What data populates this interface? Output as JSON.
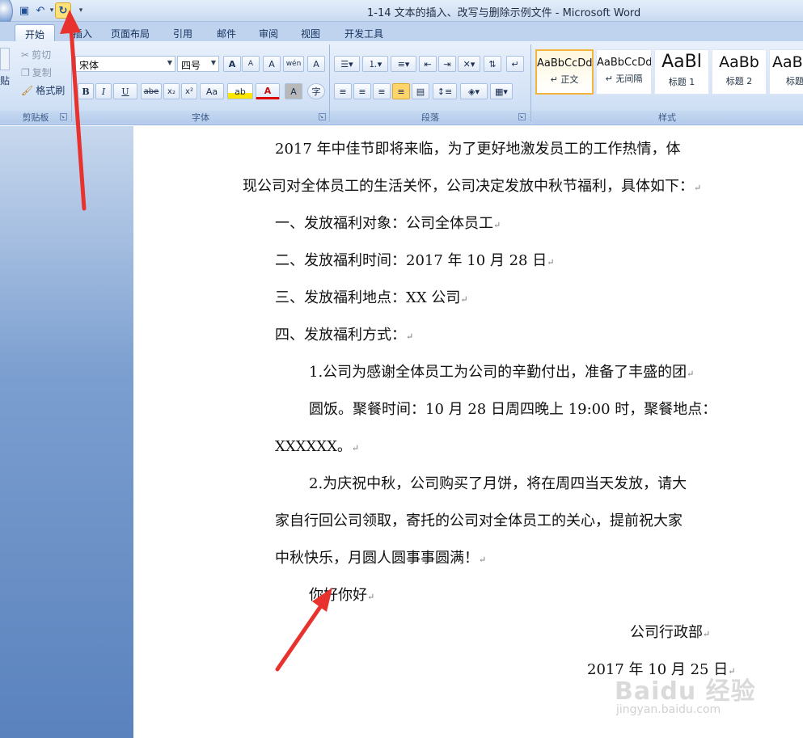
{
  "window": {
    "title": "1-14 文本的插入、改写与删除示例文件 - Microsoft Word"
  },
  "quick_access": {
    "save_icon": "save-icon",
    "undo_icon": "undo-icon",
    "redo_icon": "redo-icon",
    "customize_icon": "customize-qat-icon"
  },
  "tabs": [
    {
      "label": "开始"
    },
    {
      "label": "插入"
    },
    {
      "label": "页面布局"
    },
    {
      "label": "引用"
    },
    {
      "label": "邮件"
    },
    {
      "label": "审阅"
    },
    {
      "label": "视图"
    },
    {
      "label": "开发工具"
    }
  ],
  "ribbon": {
    "clipboard": {
      "paste_label": "贴",
      "cut_label": "剪切",
      "copy_label": "复制",
      "format_painter_label": "格式刷",
      "group_label": "剪贴板"
    },
    "font": {
      "font_name": "宋体",
      "font_size": "四号",
      "bold": "B",
      "italic": "I",
      "underline": "U",
      "strike": "abe",
      "subscript": "x₂",
      "superscript": "x²",
      "change_case": "Aa",
      "grow": "A",
      "shrink": "A",
      "clear": "A",
      "phonetic": "wén",
      "border_char": "A",
      "highlight": "ab",
      "font_color": "A",
      "shade": "A",
      "enclose": "字",
      "group_label": "字体"
    },
    "paragraph": {
      "group_label": "段落"
    },
    "styles": {
      "items": [
        {
          "sample": "AaBbCcDd",
          "name": "↵ 正文"
        },
        {
          "sample": "AaBbCcDd",
          "name": "↵ 无间隔"
        },
        {
          "sample": "AaBl",
          "name": "标题 1"
        },
        {
          "sample": "AaBb",
          "name": "标题 2"
        },
        {
          "sample": "AaB",
          "name": "标题"
        }
      ],
      "group_label": "样式"
    }
  },
  "document": {
    "lines": [
      "2017 年中佳节即将来临，为了更好地激发员工的工作热情，体",
      "现公司对全体员工的生活关怀，公司决定发放中秋节福利，具体如下：",
      "一、发放福利对象：公司全体员工",
      "二、发放福利时间：2017 年 10 月 28 日",
      "三、发放福利地点：XX 公司",
      "四、发放福利方式：",
      "1.公司为感谢全体员工为公司的辛勤付出，准备了丰盛的团",
      "圆饭。聚餐时间：10 月 28 日周四晚上 19:00 时，聚餐地点：",
      "XXXXXX。",
      "2.为庆祝中秋，公司购买了月饼，将在周四当天发放，请大",
      "家自行回公司领取，寄托的公司对全体员工的关心，提前祝大家",
      "中秋快乐，月圆人圆事事圆满！",
      "你好你好",
      "公司行政部",
      "2017 年 10 月 25 日"
    ],
    "paragraph_mark": "↵"
  },
  "watermark": {
    "logo_text": "Baidu 经验",
    "url": "jingyan.baidu.com"
  },
  "colors": {
    "ribbon_bg": "#d3e2f6",
    "left_pane": "#5a82bd",
    "arrow": "#e8322e",
    "style_active_border": "#f2b53e"
  }
}
